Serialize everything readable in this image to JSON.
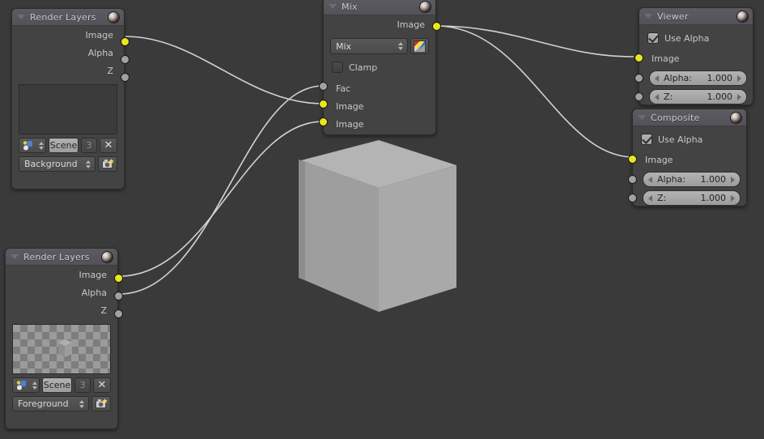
{
  "editor": {
    "background_color": "#3a3a3a",
    "backdrop": "rendered-grey-cube"
  },
  "colors": {
    "node_body": "#434343",
    "node_header": "#57555c",
    "socket_image": "#e8e81e",
    "socket_value": "#a1a1a1",
    "noodle": "#cfcfcf",
    "text": "#c8c8c8"
  },
  "nodes": {
    "render_layers_background": {
      "title": "Render Layers",
      "outputs": [
        {
          "label": "Image",
          "type": "image"
        },
        {
          "label": "Alpha",
          "type": "value"
        },
        {
          "label": "Z",
          "type": "value"
        }
      ],
      "preview": "empty-dark-preview",
      "scene_name": "Scene",
      "scene_users": "3",
      "unlink_label": "✕",
      "layer_name": "Background"
    },
    "render_layers_foreground": {
      "title": "Render Layers",
      "outputs": [
        {
          "label": "Image",
          "type": "image"
        },
        {
          "label": "Alpha",
          "type": "value"
        },
        {
          "label": "Z",
          "type": "value"
        }
      ],
      "preview": "checkerboard-with-cube",
      "scene_name": "Scene",
      "scene_users": "3",
      "unlink_label": "✕",
      "layer_name": "Foreground"
    },
    "mix": {
      "title": "Mix",
      "outputs": [
        {
          "label": "Image",
          "type": "image"
        }
      ],
      "blend_mode": "Mix",
      "clamp_label": "Clamp",
      "clamp_checked": false,
      "inputs": [
        {
          "label": "Fac",
          "type": "value"
        },
        {
          "label": "Image",
          "type": "image"
        },
        {
          "label": "Image",
          "type": "image"
        }
      ]
    },
    "viewer": {
      "title": "Viewer",
      "use_alpha_label": "Use Alpha",
      "use_alpha_checked": true,
      "image_input_label": "Image",
      "sliders": [
        {
          "label": "Alpha:",
          "value": "1.000"
        },
        {
          "label": "Z:",
          "value": "1.000"
        }
      ]
    },
    "composite": {
      "title": "Composite",
      "use_alpha_label": "Use Alpha",
      "use_alpha_checked": true,
      "image_input_label": "Image",
      "sliders": [
        {
          "label": "Alpha:",
          "value": "1.000"
        },
        {
          "label": "Z:",
          "value": "1.000"
        }
      ]
    }
  },
  "links": [
    {
      "from": "render_layers_background.Image",
      "to": "mix.Image_1"
    },
    {
      "from": "render_layers_foreground.Image",
      "to": "mix.Image_2"
    },
    {
      "from": "render_layers_foreground.Alpha",
      "to": "mix.Fac"
    },
    {
      "from": "mix.Image",
      "to": "viewer.Image"
    },
    {
      "from": "mix.Image",
      "to": "composite.Image"
    }
  ]
}
